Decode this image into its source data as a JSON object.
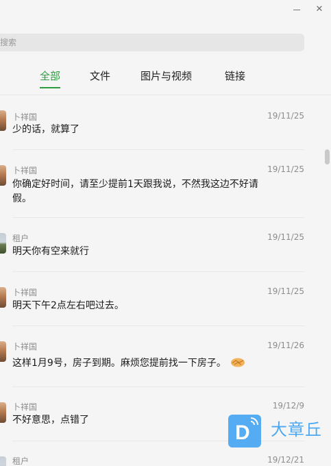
{
  "window": {
    "minimize_icon": "minimize-icon",
    "close_glyph": "✕"
  },
  "search": {
    "placeholder": "搜索"
  },
  "tabs": [
    {
      "label": "全部",
      "active": true
    },
    {
      "label": "文件",
      "active": false
    },
    {
      "label": "图片与视频",
      "active": false
    },
    {
      "label": "链接",
      "active": false
    }
  ],
  "messages": [
    {
      "sender": "卜祥国",
      "date": "19/11/25",
      "text": "少的话，就算了",
      "avatar": "avatar-brown"
    },
    {
      "sender": "卜祥国",
      "date": "19/11/25",
      "text": "你确定好时间，请至少提前1天跟我说，不然我这边不好请假。",
      "avatar": "avatar-brown"
    },
    {
      "sender": "租户",
      "date": "19/11/25",
      "text": "明天你有空来就行",
      "avatar": "avatar-green"
    },
    {
      "sender": "卜祥国",
      "date": "19/11/25",
      "text": "明天下午2点左右吧过去。",
      "avatar": "avatar-brown"
    },
    {
      "sender": "卜祥国",
      "date": "19/11/26",
      "text": "这样1月9号，房子到期。麻烦您提前找一下房子。",
      "avatar": "avatar-brown",
      "emoji": "handshake-emoji"
    },
    {
      "sender": "卜祥国",
      "date": "19/12/9",
      "text": "不好意思，点错了",
      "avatar": "avatar-brown"
    },
    {
      "sender": "租户",
      "date": "19/12/21",
      "text": "",
      "avatar": "avatar-green"
    }
  ],
  "watermark": {
    "logo_letter": "D",
    "title": "大章丘",
    "icon": "watermark-logo-icon"
  }
}
